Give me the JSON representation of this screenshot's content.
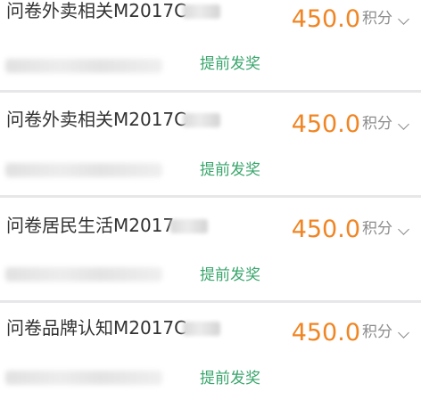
{
  "items": [
    {
      "title": "问卷外卖相关M2017C",
      "points_value": "450.0",
      "points_unit": "积分",
      "action_label": "提前发奖"
    },
    {
      "title": "问卷外卖相关M2017C",
      "points_value": "450.0",
      "points_unit": "积分",
      "action_label": "提前发奖"
    },
    {
      "title": "问卷居民生活M2017",
      "points_value": "450.0",
      "points_unit": "积分",
      "action_label": "提前发奖"
    },
    {
      "title": "问卷品牌认知M2017C",
      "points_value": "450.0",
      "points_unit": "积分",
      "action_label": "提前发奖"
    }
  ],
  "colors": {
    "points": "#f08523",
    "action": "#3aa66d",
    "separator": "#e7e7e9"
  },
  "icons": [
    "chevron-down-icon"
  ]
}
